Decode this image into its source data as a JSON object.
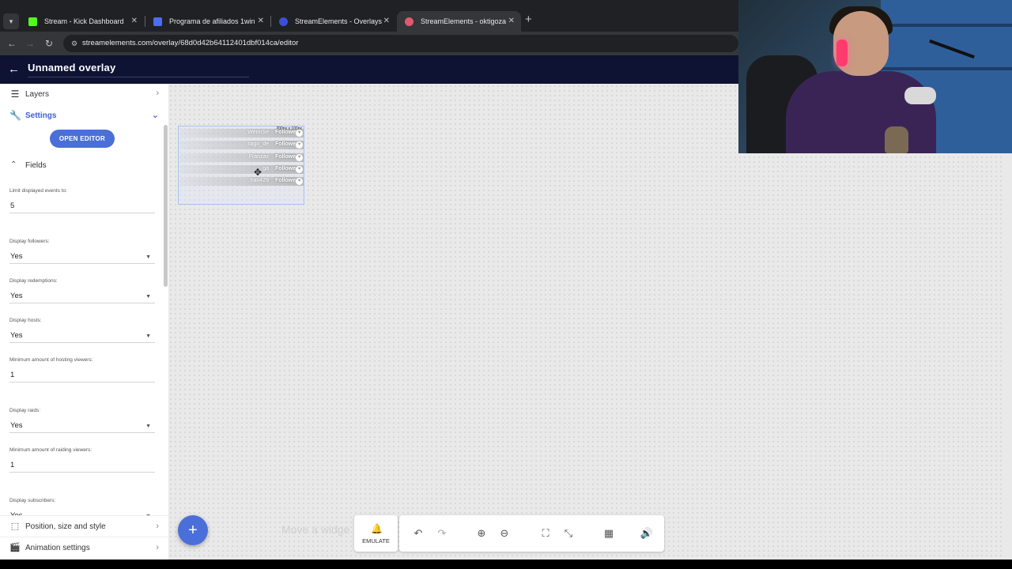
{
  "browser": {
    "tabs": [
      {
        "title": "Stream - Kick Dashboard",
        "favicon_color": "#53fc18",
        "active": false
      },
      {
        "title": "Programa de afiliados 1win",
        "favicon_color": "#4a6cf7",
        "active": false
      },
      {
        "title": "StreamElements - Overlays",
        "favicon_color": "#3b4fd8",
        "active": false
      },
      {
        "title": "StreamElements - oktigoza",
        "favicon_color": "#e05a6b",
        "active": true
      }
    ],
    "url": "streamelements.com/overlay/68d0d42b64112401dbf014ca/editor"
  },
  "header": {
    "title": "Unnamed overlay"
  },
  "sidebar": {
    "layers_label": "Layers",
    "settings_label": "Settings",
    "open_editor_label": "OPEN EDITOR",
    "fields_label": "Fields",
    "fields": [
      {
        "label": "Limit displayed events to:",
        "value": "5",
        "type": "input"
      },
      {
        "label": "Display followers:",
        "value": "Yes",
        "type": "select"
      },
      {
        "label": "Display redemptions:",
        "value": "Yes",
        "type": "select"
      },
      {
        "label": "Display hosts:",
        "value": "Yes",
        "type": "select"
      },
      {
        "label": "Minimum amount of hosting viewers:",
        "value": "1",
        "type": "input"
      },
      {
        "label": "Display raids:",
        "value": "Yes",
        "type": "select"
      },
      {
        "label": "Minimum amount of raiding viewers:",
        "value": "1",
        "type": "input"
      },
      {
        "label": "Display subscribers:",
        "value": "Yes",
        "type": "select"
      }
    ],
    "position_label": "Position, size and style",
    "animation_label": "Animation settings"
  },
  "widget": {
    "size_label": "200px x 100px",
    "events": [
      {
        "name": "WennSe",
        "type": "Followe"
      },
      {
        "name": "tiago_de",
        "type": "Followe"
      },
      {
        "name": "Franzax",
        "type": "Followe"
      },
      {
        "name": "ga",
        "type": "Followe"
      },
      {
        "name": "fran429",
        "type": "Followe"
      }
    ]
  },
  "canvas": {
    "hint": "Move a widge"
  },
  "toolbar": {
    "emulate_label": "EMULATE",
    "buttons": [
      "undo-icon",
      "redo-icon",
      "zoom-in-icon",
      "zoom-out-icon",
      "fullscreen-icon",
      "exit-fullscreen-icon",
      "grid-icon",
      "volume-icon"
    ]
  },
  "colors": {
    "accent": "#4a6fd8",
    "header_bg": "#0e1233"
  }
}
